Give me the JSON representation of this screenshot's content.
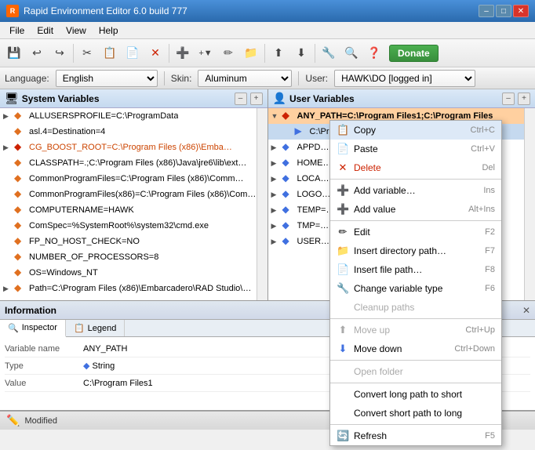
{
  "app": {
    "title": "Rapid Environment Editor 6.0 build 777",
    "icon": "R"
  },
  "title_buttons": {
    "minimize": "–",
    "maximize": "□",
    "close": "✕"
  },
  "menu": {
    "items": [
      "File",
      "Edit",
      "View",
      "Help"
    ]
  },
  "toolbar": {
    "buttons": [
      "💾",
      "↩",
      "↪",
      "✂",
      "📋",
      "🗑",
      "➕",
      "⬆",
      "⬇",
      "🔧",
      "🔍",
      "❓"
    ],
    "donate_label": "Donate"
  },
  "settings": {
    "language_label": "Language:",
    "language_value": "English",
    "skin_label": "Skin:",
    "skin_value": "Aluminum",
    "user_label": "User:",
    "user_value": "HAWK\\DO [logged in]"
  },
  "system_panel": {
    "title": "System Variables",
    "items": [
      {
        "text": "ALLUSERSPROFILE=C:\\ProgramData",
        "type": "normal"
      },
      {
        "text": "asl.4=Destination=4",
        "type": "normal"
      },
      {
        "text": "CG_BOOST_ROOT=C:\\Program Files (x86)\\Emba…",
        "type": "red"
      },
      {
        "text": "CLASSPATH=.;C:\\Program Files (x86)\\Java\\jre6\\lib\\ext…",
        "type": "normal"
      },
      {
        "text": "CommonProgramFiles=C:\\Program Files (x86)\\Comm…",
        "type": "normal"
      },
      {
        "text": "CommonProgramFiles(x86)=C:\\Program Files (x86)\\Com…",
        "type": "normal"
      },
      {
        "text": "COMPUTERNAME=HAWK",
        "type": "normal"
      },
      {
        "text": "ComSpec=%SystemRoot%\\system32\\cmd.exe",
        "type": "normal"
      },
      {
        "text": "FP_NO_HOST_CHECK=NO",
        "type": "normal"
      },
      {
        "text": "NUMBER_OF_PROCESSORS=8",
        "type": "normal"
      },
      {
        "text": "OS=Windows_NT",
        "type": "normal"
      },
      {
        "text": "Path=C:\\Program Files (x86)\\Embarcadero\\RAD Studio\\…",
        "type": "normal"
      }
    ]
  },
  "user_panel": {
    "title": "User Variables",
    "items": [
      {
        "text": "ANY_PATH=C:\\Program Files1;C:\\Program Files",
        "type": "highlighted"
      },
      {
        "text": "C:\\Pr…",
        "type": "sub"
      },
      {
        "text": "APPD…",
        "type": "normal"
      },
      {
        "text": "HOME…",
        "type": "normal"
      },
      {
        "text": "LOCA…",
        "type": "normal"
      },
      {
        "text": "LOGO…",
        "type": "normal"
      },
      {
        "text": "TEMP=…",
        "type": "normal"
      },
      {
        "text": "TMP=…",
        "type": "normal"
      },
      {
        "text": "USER…",
        "type": "normal"
      }
    ]
  },
  "info_pane": {
    "title": "Information",
    "close_btn": "✕",
    "tabs": [
      {
        "label": "Inspector",
        "icon": "🔍"
      },
      {
        "label": "Legend",
        "icon": "📋"
      }
    ],
    "active_tab": 0,
    "fields": [
      {
        "key": "Variable name",
        "value": "ANY_PATH"
      },
      {
        "key": "Type",
        "value": "String"
      },
      {
        "key": "Value",
        "value": "C:\\Program Files1"
      }
    ]
  },
  "status": {
    "text": "Modified",
    "icon": "✏️"
  },
  "context_menu": {
    "items": [
      {
        "label": "Copy",
        "shortcut": "Ctrl+C",
        "icon": "📋",
        "type": "normal"
      },
      {
        "label": "Paste",
        "shortcut": "Ctrl+V",
        "icon": "📄",
        "type": "normal"
      },
      {
        "label": "Delete",
        "shortcut": "Del",
        "icon": "✕",
        "type": "red"
      },
      {
        "label": "Add variable…",
        "shortcut": "Ins",
        "icon": "➕",
        "type": "normal"
      },
      {
        "label": "Add value",
        "shortcut": "Alt+Ins",
        "icon": "➕",
        "type": "normal"
      },
      {
        "label": "Edit",
        "shortcut": "F2",
        "icon": "✏",
        "type": "normal"
      },
      {
        "label": "Insert directory path…",
        "shortcut": "F7",
        "icon": "📁",
        "type": "normal"
      },
      {
        "label": "Insert file path…",
        "shortcut": "F8",
        "icon": "📄",
        "type": "normal"
      },
      {
        "label": "Change variable type",
        "shortcut": "F6",
        "icon": "🔧",
        "type": "normal"
      },
      {
        "label": "Cleanup paths",
        "shortcut": "",
        "icon": "",
        "type": "disabled"
      },
      {
        "label": "Move up",
        "shortcut": "Ctrl+Up",
        "icon": "⬆",
        "type": "disabled"
      },
      {
        "label": "Move down",
        "shortcut": "Ctrl+Down",
        "icon": "⬇",
        "type": "normal"
      },
      {
        "label": "Open folder",
        "shortcut": "",
        "icon": "",
        "type": "disabled"
      },
      {
        "label": "Convert long path to short",
        "shortcut": "",
        "icon": "",
        "type": "normal"
      },
      {
        "label": "Convert short path to long",
        "shortcut": "",
        "icon": "",
        "type": "normal"
      },
      {
        "label": "Refresh",
        "shortcut": "F5",
        "icon": "🔄",
        "type": "normal"
      }
    ]
  }
}
